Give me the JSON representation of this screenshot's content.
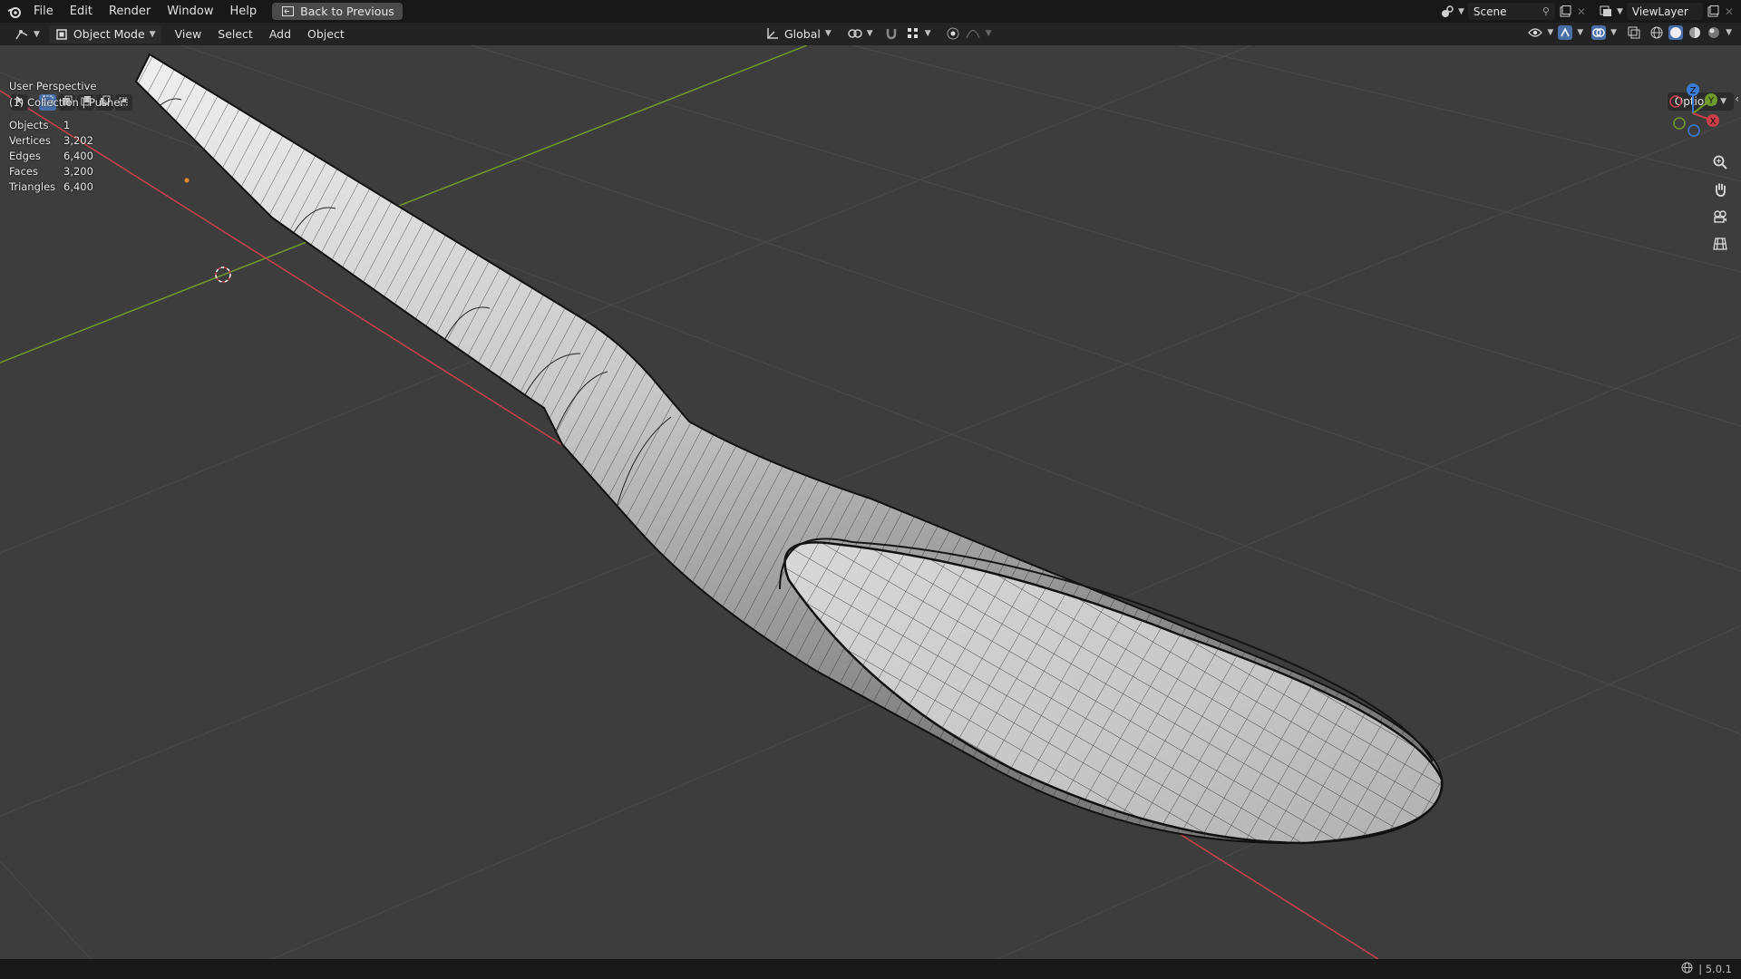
{
  "menubar": {
    "items": [
      "File",
      "Edit",
      "Render",
      "Window",
      "Help"
    ],
    "back_button": "Back to Previous",
    "scene_label": "Scene",
    "viewlayer_label": "ViewLayer"
  },
  "header": {
    "mode": "Object Mode",
    "menus": [
      "View",
      "Select",
      "Add",
      "Object"
    ],
    "transform_orientation": "Global",
    "options_label": "Options"
  },
  "viewport_info": {
    "perspective": "User Perspective",
    "collection": "(1) Collection | Pusher",
    "stats": [
      {
        "label": "Objects",
        "value": "1"
      },
      {
        "label": "Vertices",
        "value": "3,202"
      },
      {
        "label": "Edges",
        "value": "6,400"
      },
      {
        "label": "Faces",
        "value": "3,200"
      },
      {
        "label": "Triangles",
        "value": "6,400"
      }
    ]
  },
  "gizmo": {
    "z": "Z",
    "y": "Y",
    "x": "X"
  },
  "status": {
    "version": "5.0.1"
  },
  "colors": {
    "x_axis": "#c93f4a",
    "y_axis": "#6f9a2b",
    "z_axis": "#3b7bd8",
    "accent": "#4a6fa8"
  }
}
